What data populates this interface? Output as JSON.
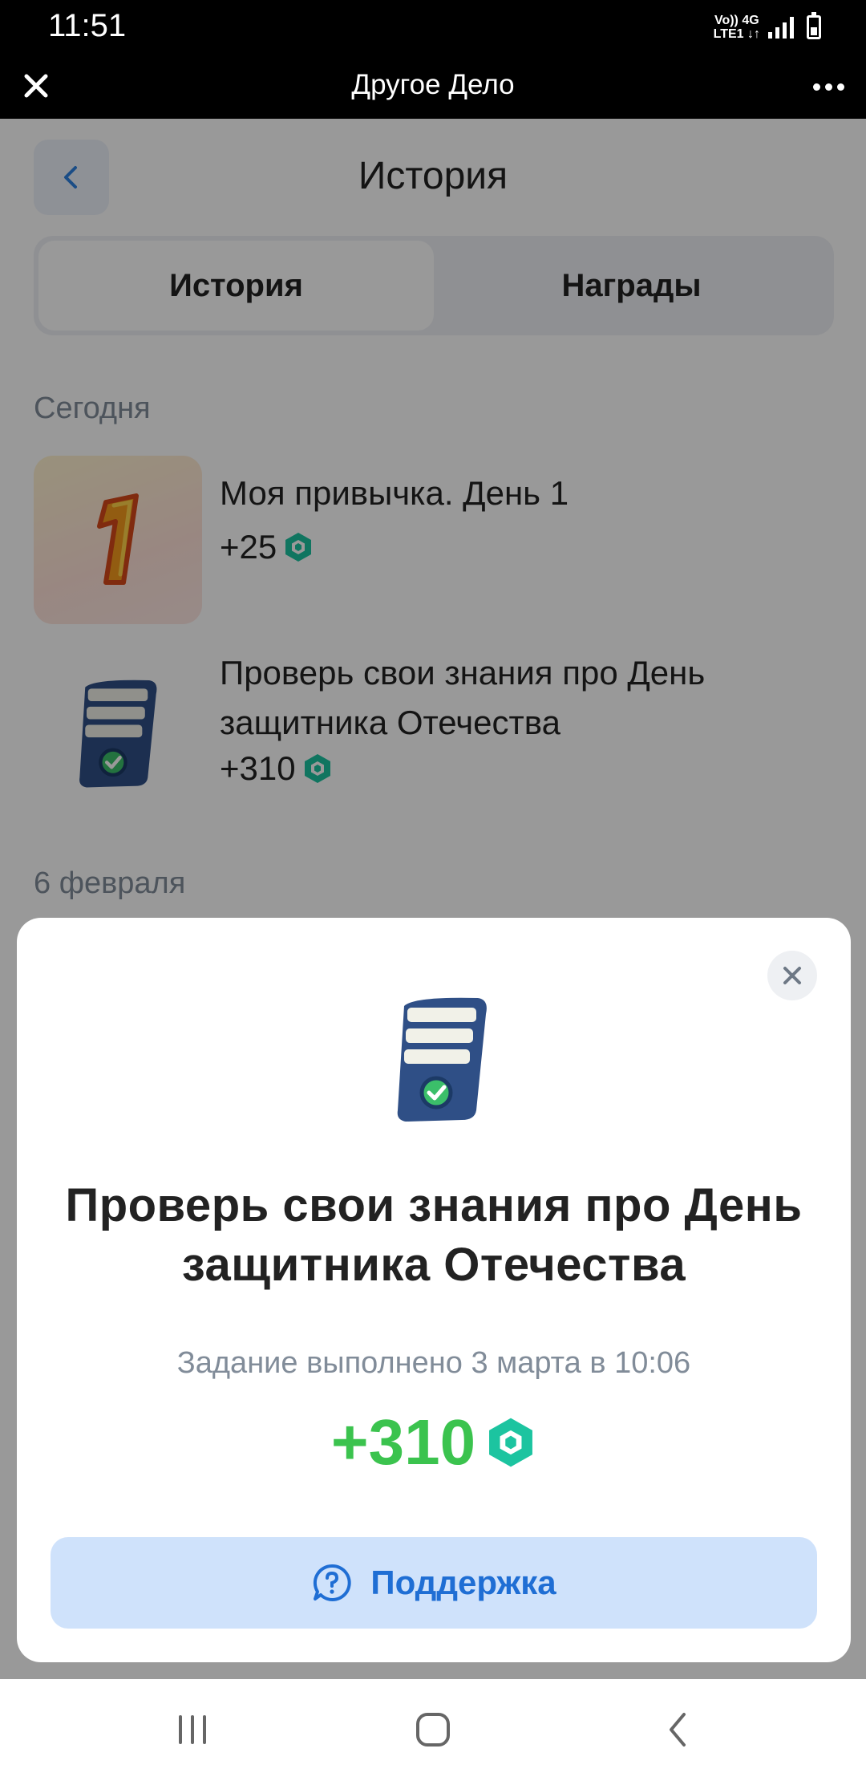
{
  "status_bar": {
    "time": "11:51",
    "network_top": "Vo))  4G",
    "network_bottom": "LTE1 ↓↑"
  },
  "app_header": {
    "title": "Другое Дело",
    "close_icon": "close-icon",
    "more_icon": "more-icon"
  },
  "page": {
    "title": "История",
    "back_icon": "chevron-left-icon",
    "tabs": [
      {
        "label": "История",
        "active": true
      },
      {
        "label": "Награды",
        "active": false
      }
    ],
    "sections": [
      {
        "label": "Сегодня",
        "items": [
          {
            "title": "Моя привычка. День 1",
            "points": "+25",
            "icon": "number-one-icon"
          },
          {
            "title": "Проверь свои знания про День защитника Отечества",
            "points": "+310",
            "icon": "quiz-scroll-icon"
          }
        ]
      },
      {
        "label": "6 февраля",
        "items": []
      }
    ]
  },
  "modal": {
    "title": "Проверь свои знания про День защитника Отечества",
    "completed_text": "Задание выполнено 3 марта в 10:06",
    "reward": "+310",
    "reward_icon": "points-hexagon-icon",
    "support_label": "Поддержка",
    "support_icon": "support-chat-icon",
    "close_icon": "close-icon"
  },
  "nav_bar": {
    "recents_icon": "recents-icon",
    "home_icon": "home-icon",
    "back_icon": "back-icon"
  },
  "colors": {
    "accent_blue": "#1f6ed4",
    "reward_green": "#3bc34e",
    "points_teal": "#1cc4a0",
    "support_bg": "#cfe2fb"
  }
}
